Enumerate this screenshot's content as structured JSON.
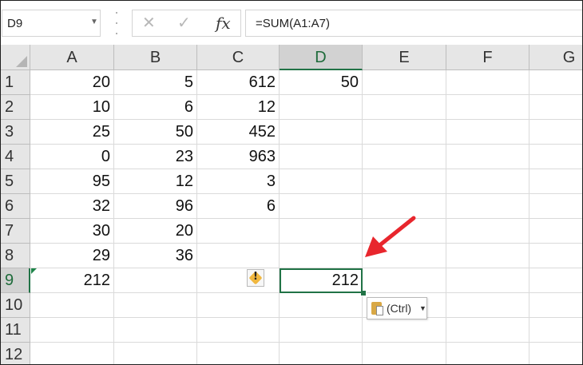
{
  "name_box": {
    "value": "D9",
    "dropdown_icon": "triangle-down-icon"
  },
  "formula_bar": {
    "cancel_icon": "close-icon",
    "enter_icon": "checkmark-icon",
    "fx_label": "fx",
    "formula": "=SUM(A1:A7)"
  },
  "columns": [
    "A",
    "B",
    "C",
    "D",
    "E",
    "F",
    "G"
  ],
  "selected_column": "D",
  "rows": [
    "1",
    "2",
    "3",
    "4",
    "5",
    "6",
    "7",
    "8",
    "9",
    "10",
    "11",
    "12"
  ],
  "selected_row": "9",
  "cells": [
    [
      "20",
      "5",
      "612",
      "50",
      "",
      "",
      ""
    ],
    [
      "10",
      "6",
      "12",
      "",
      "",
      "",
      ""
    ],
    [
      "25",
      "50",
      "452",
      "",
      "",
      "",
      ""
    ],
    [
      "0",
      "23",
      "963",
      "",
      "",
      "",
      ""
    ],
    [
      "95",
      "12",
      "3",
      "",
      "",
      "",
      ""
    ],
    [
      "32",
      "96",
      "6",
      "",
      "",
      "",
      ""
    ],
    [
      "30",
      "20",
      "",
      "",
      "",
      "",
      ""
    ],
    [
      "29",
      "36",
      "",
      "",
      "",
      "",
      ""
    ],
    [
      "212",
      "",
      "",
      "212",
      "",
      "",
      ""
    ],
    [
      "",
      "",
      "",
      "",
      "",
      "",
      ""
    ],
    [
      "",
      "",
      "",
      "",
      "",
      "",
      ""
    ],
    [
      "",
      "",
      "",
      "",
      "",
      "",
      ""
    ]
  ],
  "error_indicator": {
    "icon": "warning-diamond-icon",
    "symbol": "!"
  },
  "paste_options": {
    "icon": "clipboard-icon",
    "label": "(Ctrl)",
    "caret_icon": "caret-down-icon"
  },
  "annotation": {
    "icon": "red-arrow-icon",
    "color": "#e8262d"
  },
  "colors": {
    "accent": "#217346",
    "error_triangle": "#1e8449",
    "warning": "#f0b73f"
  }
}
